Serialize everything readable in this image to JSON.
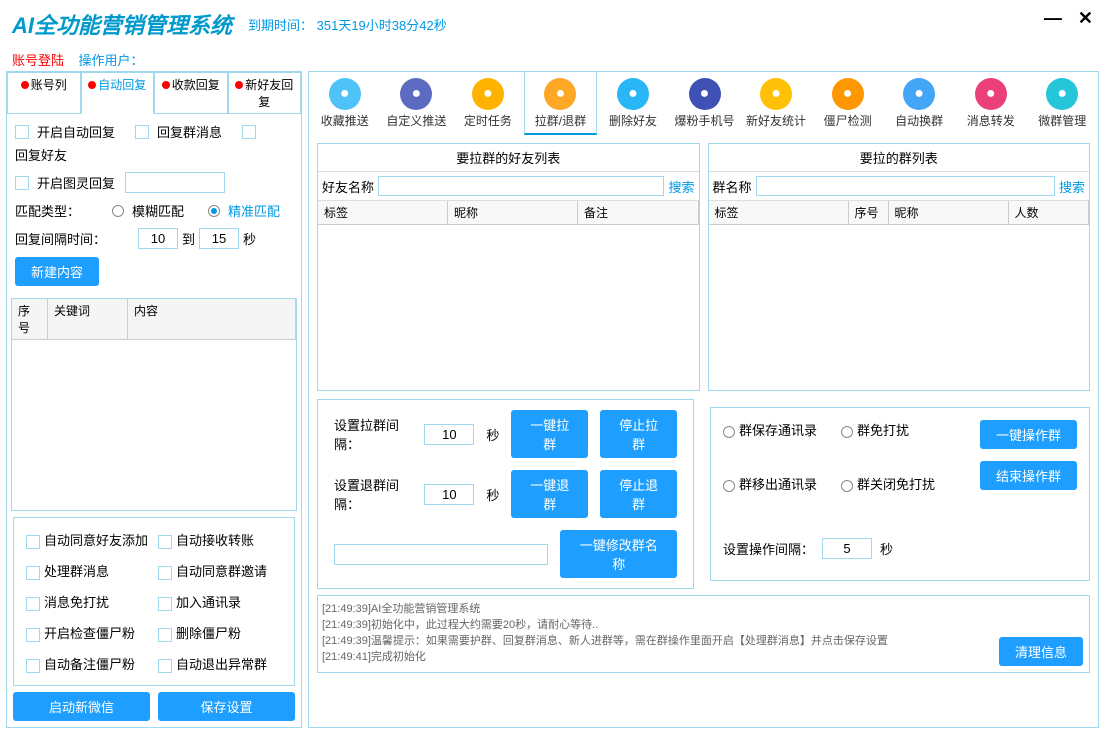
{
  "title": "AI全功能营销管理系统",
  "expiry": "到期时间： 351天19小时38分42秒",
  "login_label": "账号登陆",
  "user_label": "操作用户：",
  "toolbar": [
    {
      "label": "收藏推送",
      "color": "#4fc3f7"
    },
    {
      "label": "自定义推送",
      "color": "#5c6bc0"
    },
    {
      "label": "定时任务",
      "color": "#ffb300"
    },
    {
      "label": "拉群/退群",
      "color": "#ffa726"
    },
    {
      "label": "删除好友",
      "color": "#29b6f6"
    },
    {
      "label": "爆粉手机号",
      "color": "#3f51b5"
    },
    {
      "label": "新好友统计",
      "color": "#ffc107"
    },
    {
      "label": "僵尸检测",
      "color": "#ff9800"
    },
    {
      "label": "自动换群",
      "color": "#42a5f5"
    },
    {
      "label": "消息转发",
      "color": "#ec407a"
    },
    {
      "label": "微群管理",
      "color": "#26c6da"
    }
  ],
  "left_tabs": [
    "账号列",
    "自动回复",
    "收款回复",
    "新好友回复"
  ],
  "cb1": "开启自动回复",
  "cb2": "回复群消息",
  "cb3": "回复好友",
  "cb4": "开启图灵回复",
  "match_label": "匹配类型：",
  "match_fuzzy": "模糊匹配",
  "match_exact": "精准匹配",
  "interval_label": "回复间隔时间：",
  "interval_from": "10",
  "interval_to": "15",
  "interval_to_lbl": "到",
  "sec": "秒",
  "new_content": "新建内容",
  "tbl_cols": {
    "a": "序号",
    "b": "关键词",
    "c": "内容"
  },
  "friend_list_title": "要拉群的好友列表",
  "group_list_title": "要拉的群列表",
  "friend_name_lbl": "好友名称",
  "group_name_lbl": "群名称",
  "search": "搜索",
  "fcols": {
    "a": "标签",
    "b": "昵称",
    "c": "备注"
  },
  "gcols": {
    "a": "标签",
    "b": "序号",
    "c": "昵称",
    "d": "人数"
  },
  "pull_interval_lbl": "设置拉群间隔：",
  "pull_val": "10",
  "quit_interval_lbl": "设置退群间隔：",
  "quit_val": "10",
  "btn_pull": "一键拉群",
  "btn_stop_pull": "停止拉群",
  "btn_quit": "一键退群",
  "btn_stop_quit": "停止退群",
  "btn_rename": "一键修改群名称",
  "ropt1": "群保存通讯录",
  "ropt2": "群免打扰",
  "ropt3": "群移出通讯录",
  "ropt4": "群关闭免打扰",
  "op_interval_lbl": "设置操作间隔：",
  "op_val": "5",
  "btn_op": "一键操作群",
  "btn_end_op": "结束操作群",
  "bopts": [
    "自动同意好友添加",
    "自动接收转账",
    "处理群消息",
    "自动同意群邀请",
    "消息免打扰",
    "加入通讯录",
    "开启检查僵尸粉",
    "删除僵尸粉",
    "自动备注僵尸粉",
    "自动退出异常群"
  ],
  "btn_new_wx": "启动新微信",
  "btn_save": "保存设置",
  "btn_clear": "清理信息",
  "log": [
    "[21:49:39]AI全功能营销管理系统",
    "[21:49:39]初始化中，此过程大约需要20秒，请耐心等待..",
    "[21:49:39]温馨提示：如果需要护群、回复群消息、新人进群等，需在群操作里面开启【处理群消息】并点击保存设置",
    "[21:49:41]完成初始化"
  ]
}
